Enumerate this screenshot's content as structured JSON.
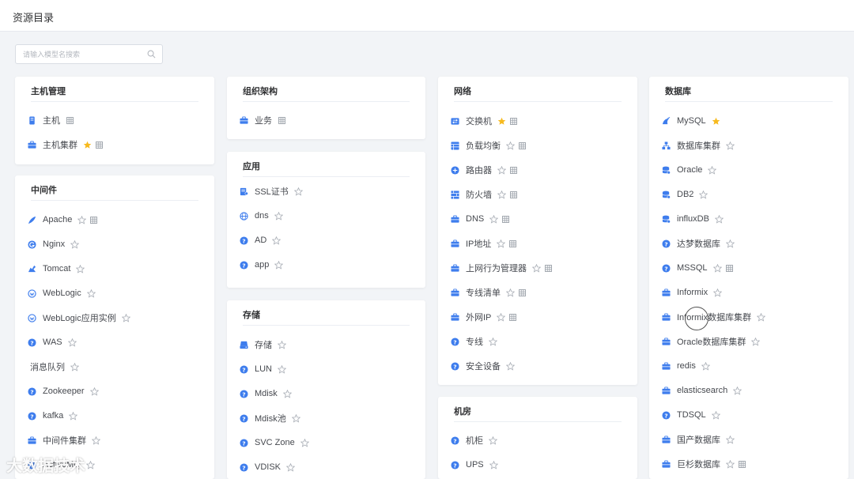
{
  "page": {
    "title": "资源目录"
  },
  "search": {
    "placeholder": "请输入模型名搜索"
  },
  "colors": {
    "accent": "#3e7ded",
    "star_filled": "#f7ba1e",
    "star_empty": "#a8adb5"
  },
  "cards": {
    "host": {
      "title": "主机管理",
      "items": [
        {
          "label": "主机",
          "icon": "server-icon",
          "star": "none",
          "grid": true
        },
        {
          "label": "主机集群",
          "icon": "briefcase-icon",
          "star": "filled",
          "grid": true
        }
      ]
    },
    "middleware": {
      "title": "中间件",
      "items": [
        {
          "label": "Apache",
          "icon": "feather-icon",
          "star": "empty",
          "grid": true
        },
        {
          "label": "Nginx",
          "icon": "g-circle-icon",
          "star": "empty",
          "grid": false
        },
        {
          "label": "Tomcat",
          "icon": "tomcat-icon",
          "star": "empty",
          "grid": false
        },
        {
          "label": "WebLogic",
          "icon": "weblogic-icon",
          "star": "empty",
          "grid": false
        },
        {
          "label": "WebLogic应用实例",
          "icon": "weblogic-icon",
          "star": "empty",
          "grid": false
        },
        {
          "label": "WAS",
          "icon": "question-icon",
          "star": "empty",
          "grid": false
        },
        {
          "label": "消息队列",
          "icon": "none",
          "star": "empty",
          "grid": false
        },
        {
          "label": "Zookeeper",
          "icon": "question-icon",
          "star": "empty",
          "grid": false
        },
        {
          "label": "kafka",
          "icon": "question-icon",
          "star": "empty",
          "grid": false
        },
        {
          "label": "中间件集群",
          "icon": "briefcase-icon",
          "star": "empty",
          "grid": false
        },
        {
          "label": "ActiveMQ",
          "icon": "question-icon",
          "star": "empty",
          "grid": false
        }
      ]
    },
    "org": {
      "title": "组织架构",
      "items": [
        {
          "label": "业务",
          "icon": "briefcase-icon",
          "star": "none",
          "grid": true
        }
      ]
    },
    "app": {
      "title": "应用",
      "items": [
        {
          "label": "SSL证书",
          "icon": "certificate-icon",
          "star": "empty",
          "grid": false
        },
        {
          "label": "dns",
          "icon": "globe-icon",
          "star": "empty",
          "grid": false
        },
        {
          "label": "AD",
          "icon": "question-icon",
          "star": "empty",
          "grid": false
        },
        {
          "label": "app",
          "icon": "question-icon",
          "star": "empty",
          "grid": false
        }
      ]
    },
    "storage": {
      "title": "存储",
      "items": [
        {
          "label": "存储",
          "icon": "storage-icon",
          "star": "empty",
          "grid": false
        },
        {
          "label": "LUN",
          "icon": "question-icon",
          "star": "empty",
          "grid": false
        },
        {
          "label": "Mdisk",
          "icon": "question-icon",
          "star": "empty",
          "grid": false
        },
        {
          "label": "Mdisk池",
          "icon": "question-icon",
          "star": "empty",
          "grid": false
        },
        {
          "label": "SVC Zone",
          "icon": "question-icon",
          "star": "empty",
          "grid": false
        },
        {
          "label": "VDISK",
          "icon": "question-icon",
          "star": "empty",
          "grid": false
        }
      ]
    },
    "network": {
      "title": "网络",
      "items": [
        {
          "label": "交换机",
          "icon": "switch-icon",
          "star": "filled",
          "grid": true
        },
        {
          "label": "负载均衡",
          "icon": "table-icon",
          "star": "empty",
          "grid": true
        },
        {
          "label": "路由器",
          "icon": "router-icon",
          "star": "empty",
          "grid": true
        },
        {
          "label": "防火墙",
          "icon": "firewall-icon",
          "star": "empty",
          "grid": true
        },
        {
          "label": "DNS",
          "icon": "briefcase-icon",
          "star": "empty",
          "grid": true
        },
        {
          "label": "IP地址",
          "icon": "briefcase-icon",
          "star": "empty",
          "grid": true
        },
        {
          "label": "上网行为管理器",
          "icon": "briefcase-icon",
          "star": "empty",
          "grid": true
        },
        {
          "label": "专线清单",
          "icon": "briefcase-icon",
          "star": "empty",
          "grid": true
        },
        {
          "label": "外网IP",
          "icon": "briefcase-icon",
          "star": "empty",
          "grid": true
        },
        {
          "label": "专线",
          "icon": "question-icon",
          "star": "empty",
          "grid": false
        },
        {
          "label": "安全设备",
          "icon": "question-icon",
          "star": "empty",
          "grid": false
        }
      ]
    },
    "room": {
      "title": "机房",
      "items": [
        {
          "label": "机柜",
          "icon": "question-icon",
          "star": "empty",
          "grid": false
        },
        {
          "label": "UPS",
          "icon": "question-icon",
          "star": "empty",
          "grid": false
        }
      ]
    },
    "database": {
      "title": "数据库",
      "items": [
        {
          "label": "MySQL",
          "icon": "mysql-icon",
          "star": "filled",
          "grid": false
        },
        {
          "label": "数据库集群",
          "icon": "cluster-icon",
          "star": "empty",
          "grid": false
        },
        {
          "label": "Oracle",
          "icon": "db-icon",
          "star": "empty",
          "grid": false
        },
        {
          "label": "DB2",
          "icon": "db-icon",
          "star": "empty",
          "grid": false
        },
        {
          "label": "influxDB",
          "icon": "db-icon",
          "star": "empty",
          "grid": false
        },
        {
          "label": "达梦数据库",
          "icon": "question-icon",
          "star": "empty",
          "grid": false
        },
        {
          "label": "MSSQL",
          "icon": "question-icon",
          "star": "empty",
          "grid": true
        },
        {
          "label": "Informix",
          "icon": "briefcase-icon",
          "star": "empty",
          "grid": false
        },
        {
          "label": "Informix数据库集群",
          "icon": "briefcase-icon",
          "star": "empty",
          "grid": false
        },
        {
          "label": "Oracle数据库集群",
          "icon": "briefcase-icon",
          "star": "empty",
          "grid": false
        },
        {
          "label": "redis",
          "icon": "briefcase-icon",
          "star": "empty",
          "grid": false
        },
        {
          "label": "elasticsearch",
          "icon": "briefcase-icon",
          "star": "empty",
          "grid": false
        },
        {
          "label": "TDSQL",
          "icon": "question-icon",
          "star": "empty",
          "grid": false
        },
        {
          "label": "国产数据库",
          "icon": "briefcase-icon",
          "star": "empty",
          "grid": false
        },
        {
          "label": "巨杉数据库",
          "icon": "briefcase-icon",
          "star": "empty",
          "grid": true
        }
      ]
    }
  },
  "watermark": {
    "text": "大数据技术"
  }
}
